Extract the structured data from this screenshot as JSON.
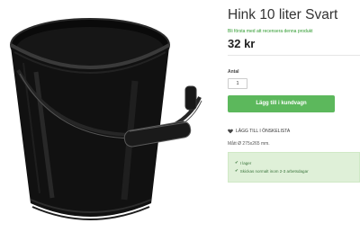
{
  "product": {
    "title": "Hink 10 liter Svart",
    "first_review_link": "Bli första med att recensera denna produkt",
    "price": "32 kr",
    "image_icon": "bucket-image"
  },
  "quantity": {
    "label": "Antal",
    "value": "1"
  },
  "cart": {
    "button_label": "Lägg till i kundvagn",
    "color": "#5cb85c"
  },
  "wishlist": {
    "label": "LÄGG TILL I ÖNSKELISTA",
    "icon": "heart-icon"
  },
  "dimensions": "Mått Ø 275x265 mm.",
  "stock": {
    "in_stock": "I lager",
    "shipping": "Skickas normalt inom 2-3 arbetsdagar",
    "icon": "check-icon",
    "color": "#3c763d"
  }
}
